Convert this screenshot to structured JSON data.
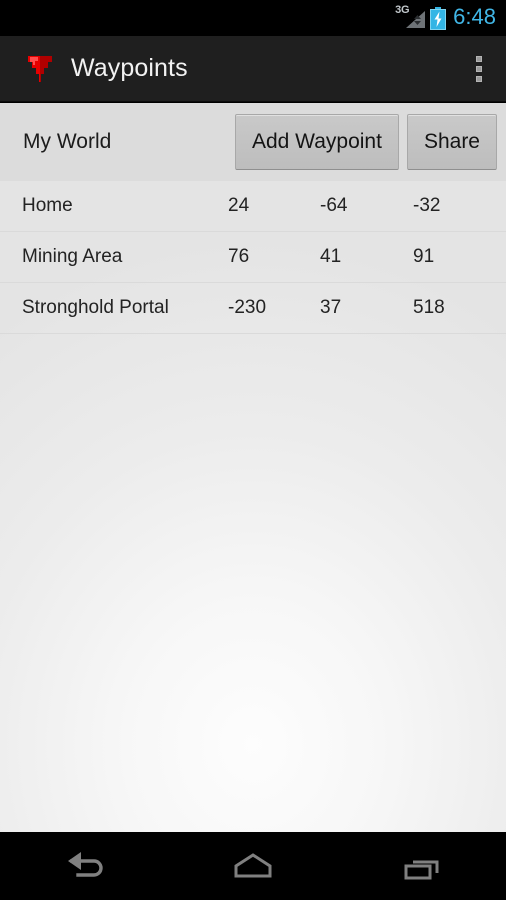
{
  "status_bar": {
    "network_label": "3G",
    "signal_icon": "signal-triangle-icon",
    "battery_icon": "battery-charging-icon",
    "time": "6:48",
    "clock_color": "#41b6e6",
    "battery_color": "#33b5e5"
  },
  "action_bar": {
    "app_icon": "waypoint-marker-icon",
    "app_icon_color": "#e00000",
    "title": "Waypoints",
    "overflow_icon": "overflow-menu-icon"
  },
  "toolbar": {
    "world_label": "My World",
    "add_waypoint_label": "Add Waypoint",
    "share_label": "Share"
  },
  "waypoints": [
    {
      "name": "Home",
      "x": "24",
      "y": "-64",
      "z": "-32"
    },
    {
      "name": "Mining Area",
      "x": "76",
      "y": "41",
      "z": "91"
    },
    {
      "name": "Stronghold Portal",
      "x": "-230",
      "y": "37",
      "z": "518"
    }
  ],
  "nav_bar": {
    "back_icon": "back-arrow-icon",
    "home_icon": "home-icon",
    "recents_icon": "recent-apps-icon",
    "icon_color": "#808080"
  }
}
